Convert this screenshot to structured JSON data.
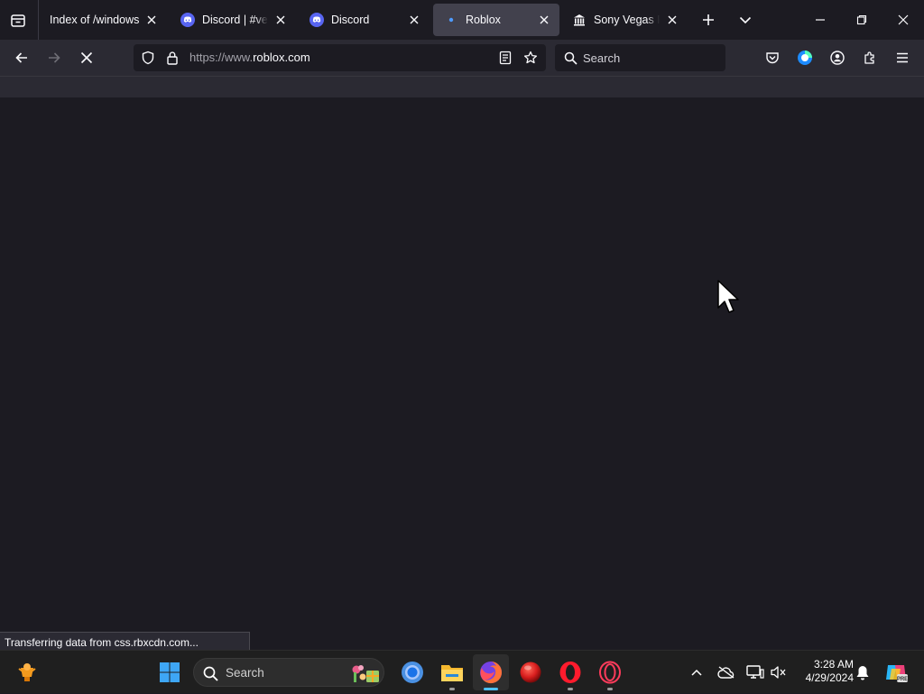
{
  "browser": {
    "tabs": [
      {
        "title": "Index of /windows/",
        "favicon": "none",
        "active": false
      },
      {
        "title": "Discord | #verify",
        "favicon": "discord-icon",
        "active": false
      },
      {
        "title": "Discord",
        "favicon": "discord-icon",
        "active": false
      },
      {
        "title": "Roblox",
        "favicon": "loading-dot-icon",
        "active": true
      },
      {
        "title": "Sony Vegas Pro",
        "favicon": "bank-icon",
        "active": false
      }
    ],
    "url": {
      "scheme": "https://www.",
      "host": "roblox.com"
    },
    "search_placeholder": "Search",
    "status_text": "Transferring data from css.rbxcdn.com...",
    "colors": {
      "accent": "#0060df",
      "tab_active": "#42414d",
      "toolbar": "#2b2a33",
      "content": "#1c1b22"
    }
  },
  "taskbar": {
    "search_placeholder": "Search",
    "time": "3:28 AM",
    "date": "4/29/2024",
    "pinned_apps": [
      "chrome-icon",
      "file-explorer-icon",
      "firefox-icon",
      "red-ball-app-icon",
      "opera-icon",
      "opera-gx-icon"
    ]
  }
}
